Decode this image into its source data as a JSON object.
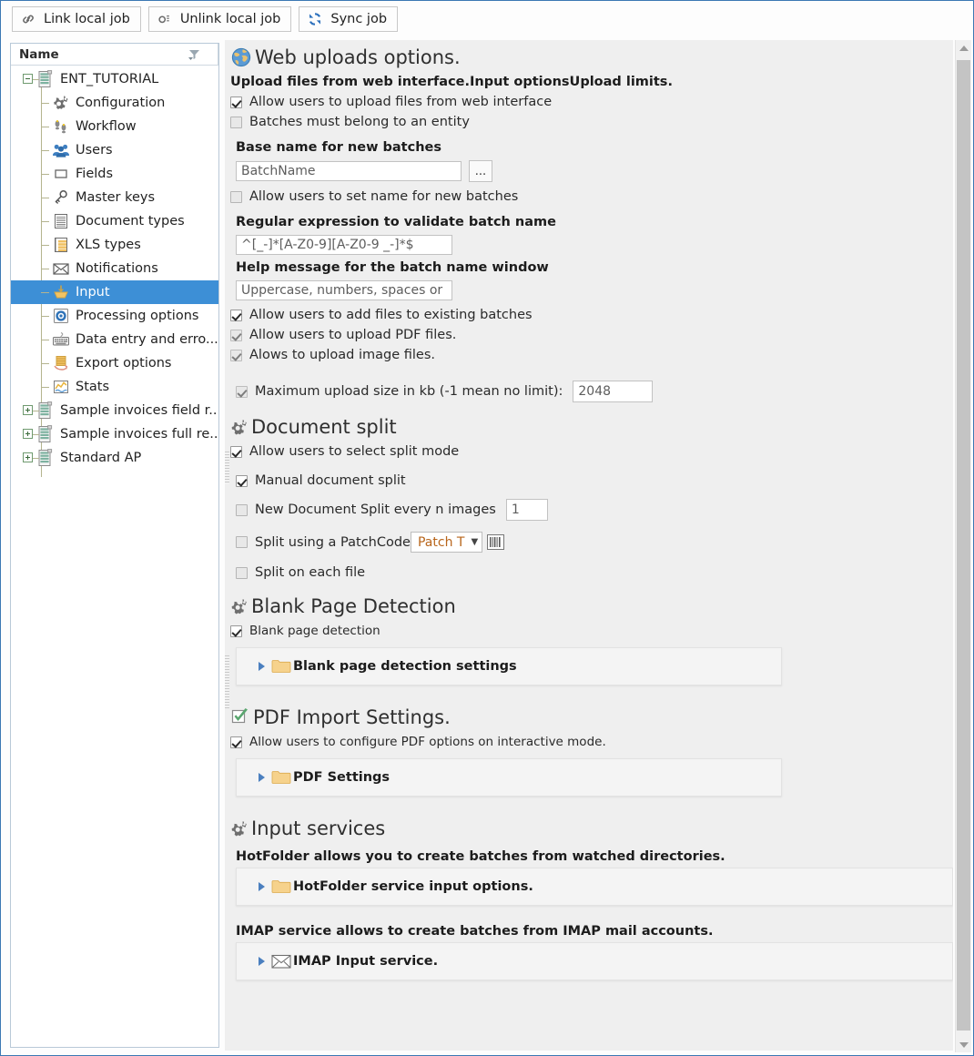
{
  "toolbar": {
    "buttons": [
      {
        "label": "Link local job",
        "icon": "link-icon"
      },
      {
        "label": "Unlink local job",
        "icon": "unlink-icon"
      },
      {
        "label": "Sync job",
        "icon": "sync-icon"
      }
    ]
  },
  "tree": {
    "header": "Name",
    "items": [
      {
        "label": "ENT_TUTORIAL",
        "icon": "server-icon",
        "level": 0,
        "expander": "minus",
        "selected": false
      },
      {
        "label": "Configuration",
        "icon": "gears-icon",
        "level": 1,
        "expander": "none",
        "selected": false
      },
      {
        "label": "Workflow",
        "icon": "footsteps-icon",
        "level": 1,
        "expander": "none",
        "selected": false
      },
      {
        "label": "Users",
        "icon": "users-icon",
        "level": 1,
        "expander": "none",
        "selected": false
      },
      {
        "label": "Fields",
        "icon": "rectangle-icon",
        "level": 1,
        "expander": "none",
        "selected": false
      },
      {
        "label": "Master keys",
        "icon": "key-icon",
        "level": 1,
        "expander": "none",
        "selected": false
      },
      {
        "label": "Document types",
        "icon": "document-list-icon",
        "level": 1,
        "expander": "none",
        "selected": false
      },
      {
        "label": "XLS types",
        "icon": "spreadsheet-icon",
        "level": 1,
        "expander": "none",
        "selected": false
      },
      {
        "label": "Notifications",
        "icon": "envelope-icon",
        "level": 1,
        "expander": "none",
        "selected": false
      },
      {
        "label": "Input",
        "icon": "inbox-icon",
        "level": 1,
        "expander": "none",
        "selected": true
      },
      {
        "label": "Processing options",
        "icon": "target-icon",
        "level": 1,
        "expander": "none",
        "selected": false
      },
      {
        "label": "Data entry and erro...",
        "icon": "keyboard-icon",
        "level": 1,
        "expander": "none",
        "selected": false
      },
      {
        "label": "Export options",
        "icon": "export-icon",
        "level": 1,
        "expander": "none",
        "selected": false
      },
      {
        "label": "Stats",
        "icon": "chart-icon",
        "level": 1,
        "expander": "none",
        "selected": false
      },
      {
        "label": "Sample invoices field r...",
        "icon": "server-icon",
        "level": 0,
        "expander": "plus",
        "selected": false
      },
      {
        "label": "Sample invoices full re...",
        "icon": "server-icon",
        "level": 0,
        "expander": "plus",
        "selected": false
      },
      {
        "label": "Standard AP",
        "icon": "server-icon",
        "level": 0,
        "expander": "plus",
        "selected": false
      }
    ]
  },
  "main": {
    "web_uploads": {
      "title": "Web uploads options.",
      "icon": "globe-icon",
      "description": "Upload files from web interface.Input optionsUpload limits.",
      "allow_upload": {
        "label": "Allow users to upload files from web interface",
        "checked": true,
        "enabled": true
      },
      "batches_entity": {
        "label": "Batches must belong to an entity",
        "checked": false,
        "enabled": true
      },
      "base_name_label": "Base name for new batches",
      "base_name_value": "BatchName",
      "browse_button": "...",
      "allow_set_name": {
        "label": "Allow users to set name for new batches",
        "checked": false,
        "enabled": true
      },
      "regex_label": "Regular expression to validate batch name",
      "regex_value": "^[_-]*[A-Z0-9][A-Z0-9 _-]*$",
      "help_label": "Help message for the batch name window",
      "help_value": "Uppercase, numbers, spaces or unders",
      "allow_add_existing": {
        "label": "Allow users to add files to existing batches",
        "checked": true,
        "enabled": true
      },
      "allow_pdf": {
        "label": "Allow users to upload PDF files.",
        "checked": true,
        "enabled": false
      },
      "allow_image": {
        "label": "Alows to upload image files.",
        "checked": true,
        "enabled": false
      },
      "max_size": {
        "label": "Maximum upload size in kb (-1 mean no limit):",
        "checked": true,
        "enabled": false,
        "value": "2048"
      }
    },
    "document_split": {
      "title": "Document split",
      "icon": "gears-icon",
      "allow_select_split": {
        "label": "Allow users to select split mode",
        "checked": true
      },
      "manual_split": {
        "label": "Manual document split",
        "checked": true
      },
      "every_n": {
        "label": "New Document Split every n images",
        "checked": false,
        "value": "1"
      },
      "patchcode": {
        "label": "Split using a PatchCode",
        "checked": false,
        "selected_option": "Patch T",
        "barcode_icon": "barcode-icon"
      },
      "each_file": {
        "label": "Split on each file",
        "checked": false
      }
    },
    "blank_page": {
      "title": "Blank Page Detection",
      "icon": "gears-icon",
      "detection": {
        "label": "Blank page detection",
        "checked": true
      },
      "settings_panel": {
        "label": "Blank page detection settings",
        "icon": "folder-icon"
      }
    },
    "pdf_import": {
      "title": "PDF Import Settings.",
      "icon": "check-icon",
      "allow_configure": {
        "label": "Allow users to configure PDF options on interactive mode.",
        "checked": true
      },
      "settings_panel": {
        "label": "PDF Settings",
        "icon": "folder-icon"
      }
    },
    "input_services": {
      "title": "Input services",
      "icon": "gears-icon",
      "hotfolder_desc": "HotFolder allows you to create batches from watched directories.",
      "hotfolder_panel": {
        "label": "HotFolder service input options.",
        "icon": "folder-icon"
      },
      "imap_desc": "IMAP service allows to create batches from IMAP mail accounts.",
      "imap_panel": {
        "label": "IMAP Input service.",
        "icon": "envelope-icon"
      }
    }
  },
  "colors": {
    "selection": "#3d8fd6",
    "window_border": "#3c78b4",
    "panel_bg": "#efefef",
    "accent_orange": "#b8651b"
  }
}
